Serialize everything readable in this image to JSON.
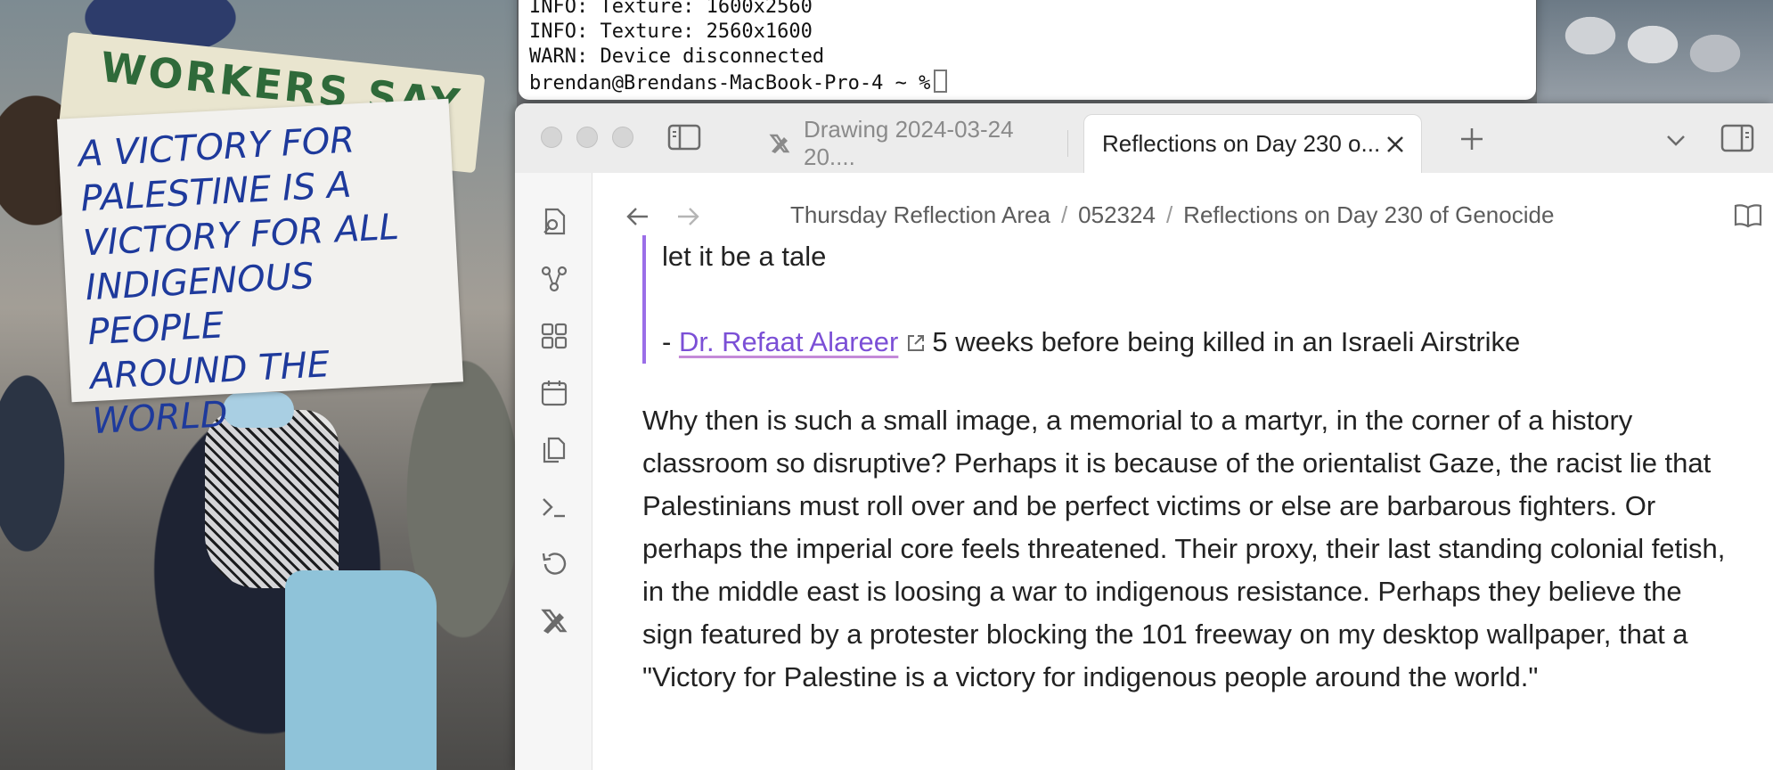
{
  "terminal": {
    "lines": [
      "INFO: Texture: 1600x2560",
      "INFO: Texture: 2560x1600",
      "WARN: Device disconnected",
      "brendan@Brendans-MacBook-Pro-4 ~ %"
    ]
  },
  "wallpaper": {
    "banner_text": "WORKERS SAY",
    "sign_text": "A VICTORY FOR\nPALESTINE IS A\nVICTORY FOR ALL\nINDIGENOUS PEOPLE\nAROUND THE WORLD"
  },
  "tabs": [
    {
      "label": "Drawing 2024-03-24 20....",
      "icon": "excalidraw-icon",
      "active": false
    },
    {
      "label": "Reflections on Day 230 o...",
      "icon": "",
      "active": true
    }
  ],
  "breadcrumb": {
    "items": [
      "Thursday Reflection Area",
      "052324",
      "Reflections on Day 230 of Genocide"
    ],
    "separator": "/"
  },
  "ribbon": {
    "icons": [
      "quick-switcher-icon",
      "graph-view-icon",
      "canvas-icon",
      "daily-note-icon",
      "templates-icon",
      "command-palette-icon",
      "history-icon",
      "excalidraw-icon"
    ]
  },
  "document": {
    "quote_line1": "let it be a tale",
    "quote_dash": "- ",
    "quote_link": "Dr. Refaat Alareer",
    "quote_rest": "5 weeks before being killed in an Israeli Airstrike",
    "paragraph": "Why then is such a small image, a memorial to a martyr, in the corner of a history classroom so disruptive? Perhaps it is because of the orientalist Gaze, the racist lie that Palestinians must roll over and be perfect victims or else are barbarous fighters. Or perhaps the imperial core feels threatened. Their proxy, their last standing colonial fetish, in the middle east is loosing a war to indigenous resistance. Perhaps they believe the sign featured by a protester blocking the 101 freeway on my desktop wallpaper, that a \"Victory for Palestine is a victory for indigenous people around the world.\""
  },
  "colors": {
    "accent": "#7b4fd6",
    "blockquote_border": "#9b6ee8",
    "titlebar": "#ececec"
  }
}
